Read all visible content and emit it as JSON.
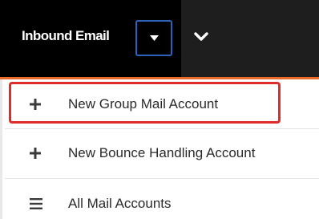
{
  "header": {
    "module_label": "Inbound Email",
    "dropdown_icon": "caret-down-icon",
    "more_icon": "chevron-down-icon"
  },
  "menu": {
    "items": [
      {
        "label": "New Group Mail Account",
        "icon": "plus-icon",
        "highlighted": true
      },
      {
        "label": "New Bounce Handling Account",
        "icon": "plus-icon",
        "highlighted": false
      },
      {
        "label": "All Mail Accounts",
        "icon": "list-icon",
        "highlighted": false
      }
    ]
  },
  "colors": {
    "nav_background": "#1e1e1e",
    "active_tab_background": "#000000",
    "accent_line": "#eb6b2c",
    "focus_border": "#2b63b8",
    "highlight_border": "#e02b2b",
    "menu_text": "#2a2a2a"
  }
}
